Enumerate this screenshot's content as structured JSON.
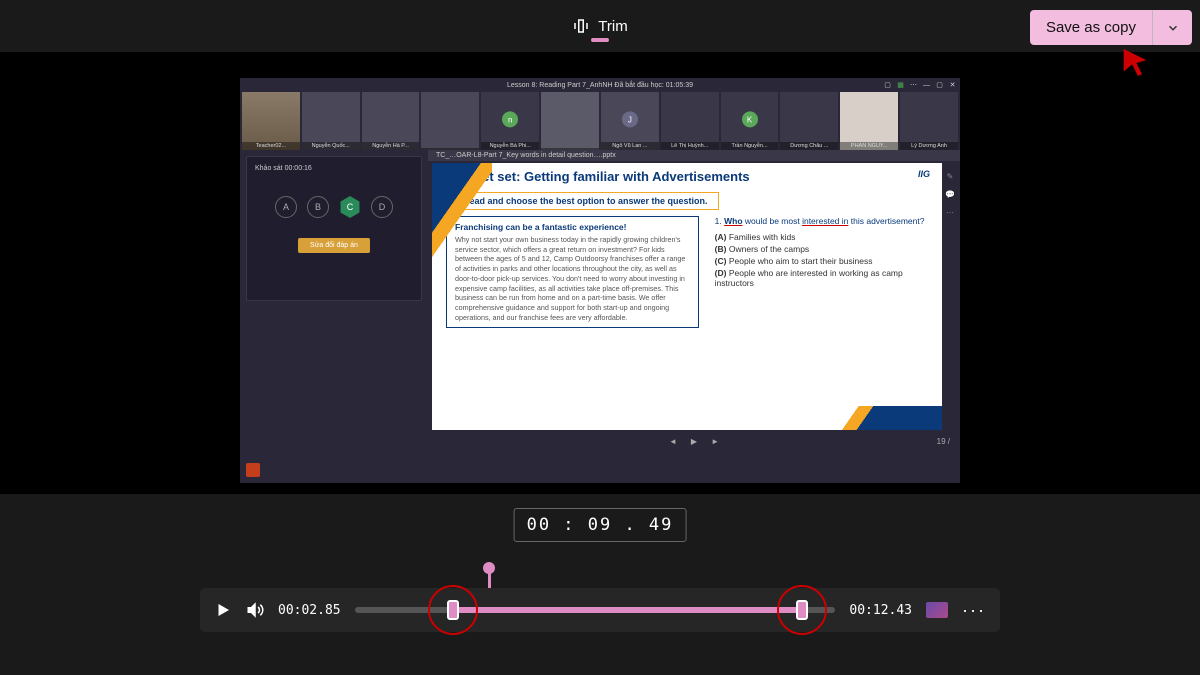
{
  "topbar": {
    "mode": "Trim",
    "save": "Save as copy"
  },
  "meeting": {
    "title": "Lesson 8: Reading Part 7_AnhNH    Đã bắt đầu học: 01:05:39",
    "participants": [
      {
        "name": "Teacher02...",
        "initial": ""
      },
      {
        "name": "Nguyễn Quốc...",
        "initial": ""
      },
      {
        "name": "Nguyễn Hà P...",
        "initial": ""
      },
      {
        "name": "",
        "initial": ""
      },
      {
        "name": "Nguyễn Bá Phi...",
        "initial": "n",
        "color": "#5aa85a"
      },
      {
        "name": "",
        "initial": ""
      },
      {
        "name": "Ngô Vũ Lan ...",
        "initial": "J",
        "color": "#6a6a88"
      },
      {
        "name": "Lê Thị Huỳnh...",
        "initial": ""
      },
      {
        "name": "Trần Nguyễn...",
        "initial": "K",
        "color": "#5aa85a"
      },
      {
        "name": "Dương Châu ...",
        "initial": ""
      },
      {
        "name": "PHAN NGUY...",
        "initial": ""
      },
      {
        "name": "Lý Dương Anh",
        "initial": ""
      }
    ]
  },
  "poll": {
    "label": "Khảo sát    00:00:16",
    "options": [
      "A",
      "B",
      "C",
      "D"
    ],
    "selected": "C",
    "button": "Sửa đổi đáp án"
  },
  "slide": {
    "tab": "TC_…OAR-L8-Part 7_Key words in detail question….pptx",
    "title": "Get set: Getting familiar with Advertisements",
    "logo": "IIG",
    "instruction": "Read and choose the best option to answer the question.",
    "passage_title": "Franchising can be a fantastic experience!",
    "passage": "Why not start your own business today in the rapidly growing children's service sector, which offers a great return on investment? For kids between the ages of 5 and 12, Camp Outdoorsy franchises offer a range of activities in parks and other locations throughout the city, as well as door-to-door pick-up services. You don't need to worry about investing in expensive camp facilities, as all activities take place off-premises. This business can be run from home and on a part-time basis. We offer comprehensive guidance and support for both start-up and ongoing operations, and our franchise fees are very affordable.",
    "question_prefix": "1. ",
    "question_u1": "Who",
    "question_mid": " would be most ",
    "question_u2": "interested in",
    "question_suffix": " this advertisement?",
    "opts": {
      "A": "Families with kids",
      "B": "Owners of the camps",
      "C": "People who aim to start their business",
      "D": "People who are interested in working as camp instructors"
    },
    "page": "19 / "
  },
  "timebox": "00 : 09 . 49",
  "player": {
    "current": "00:02.85",
    "end": "00:12.43"
  }
}
